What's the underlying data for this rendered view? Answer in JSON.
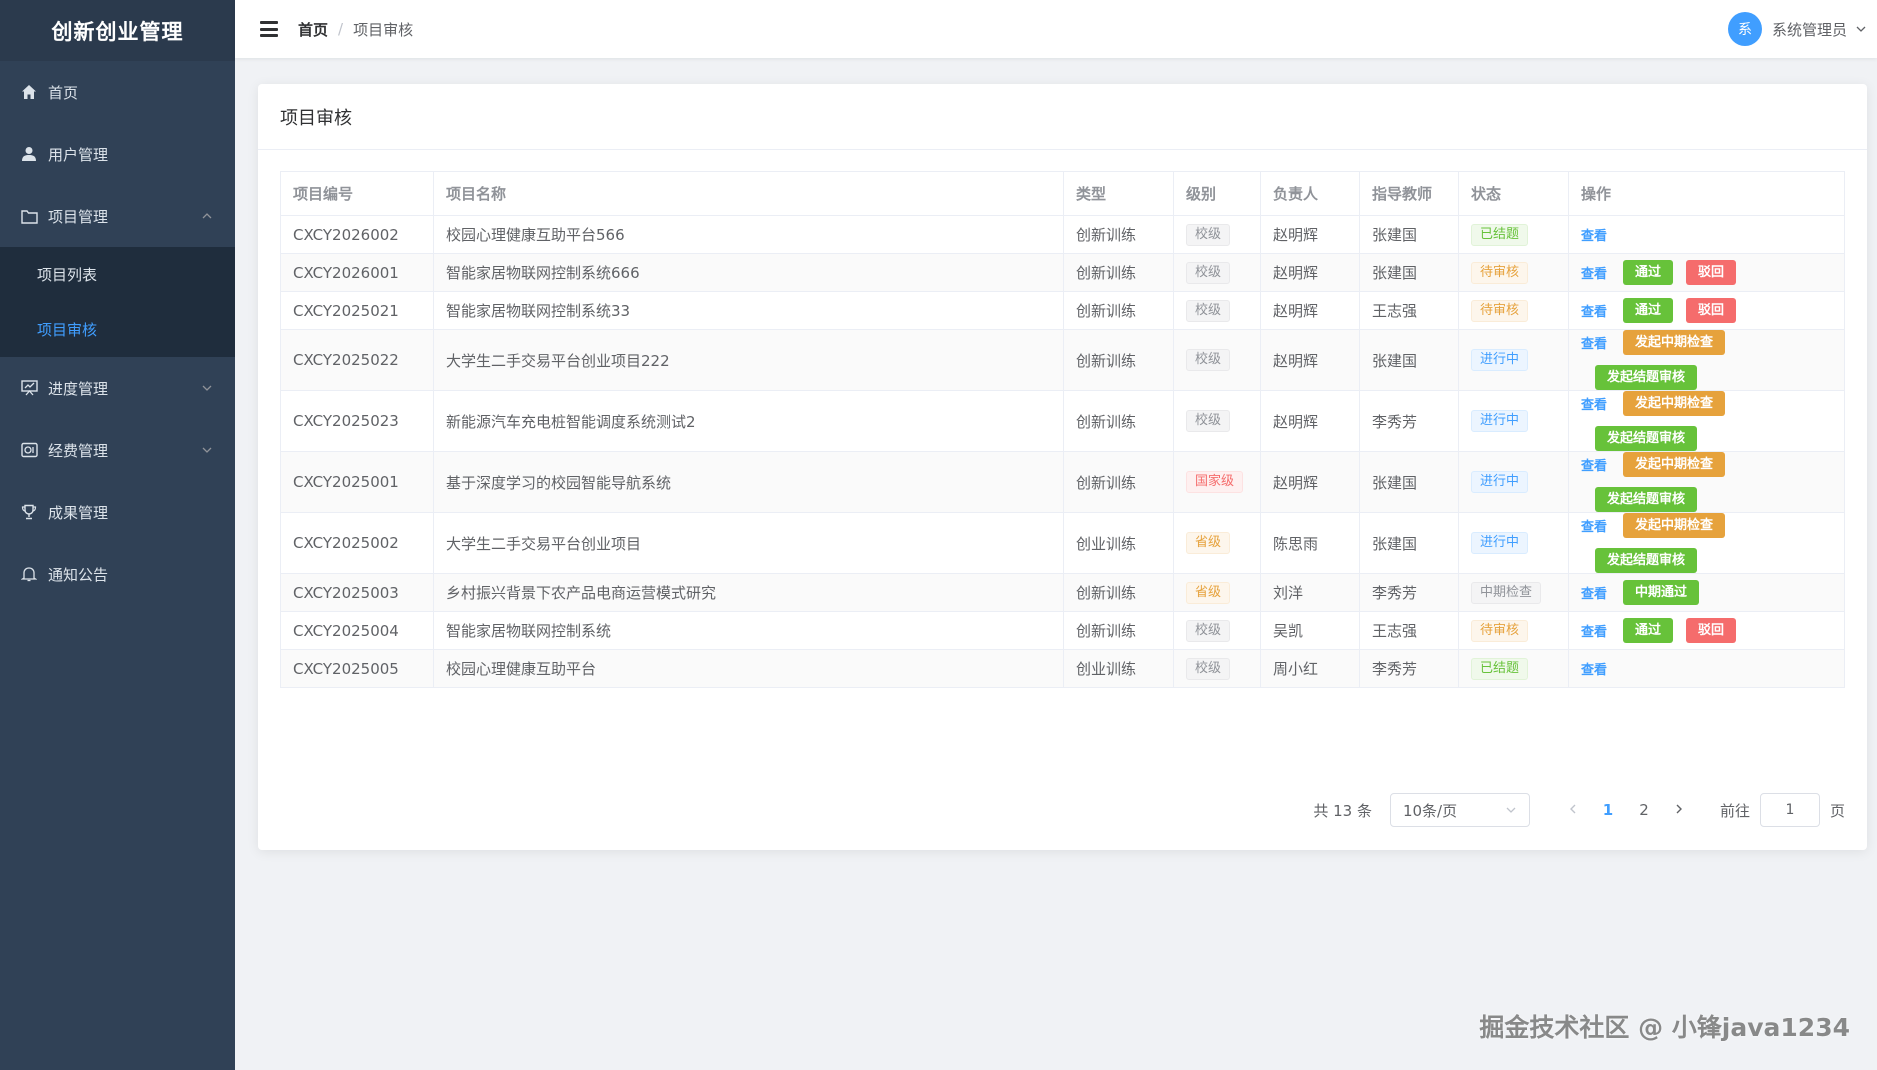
{
  "app": {
    "title": "创新创业管理"
  },
  "sidebar": {
    "items": [
      {
        "label": "首页",
        "icon": "home-icon"
      },
      {
        "label": "用户管理",
        "icon": "user-icon"
      },
      {
        "label": "项目管理",
        "icon": "folder-icon"
      },
      {
        "label": "进度管理",
        "icon": "progress-icon"
      },
      {
        "label": "经费管理",
        "icon": "funds-icon"
      },
      {
        "label": "成果管理",
        "icon": "trophy-icon"
      },
      {
        "label": "通知公告",
        "icon": "bell-icon"
      }
    ],
    "sub_items": [
      {
        "label": "项目列表"
      },
      {
        "label": "项目审核",
        "active": true
      }
    ]
  },
  "header": {
    "breadcrumb": {
      "home": "首页",
      "separator": "/",
      "current": "项目审核"
    },
    "user": {
      "avatar_text": "系",
      "name": "系统管理员"
    }
  },
  "card": {
    "title": "项目审核"
  },
  "table": {
    "columns": [
      "项目编号",
      "项目名称",
      "类型",
      "级别",
      "负责人",
      "指导教师",
      "状态",
      "操作"
    ],
    "rows": [
      {
        "code": "CXCY2026002",
        "name": "校园心理健康互助平台566",
        "type": "创新训练",
        "level": "校级",
        "leader": "赵明辉",
        "teacher": "张建国",
        "status": "已结题",
        "ops": [
          "查看"
        ]
      },
      {
        "code": "CXCY2026001",
        "name": "智能家居物联网控制系统666",
        "type": "创新训练",
        "level": "校级",
        "leader": "赵明辉",
        "teacher": "张建国",
        "status": "待审核",
        "ops": [
          "查看",
          "通过",
          "驳回"
        ]
      },
      {
        "code": "CXCY2025021",
        "name": "智能家居物联网控制系统33",
        "type": "创新训练",
        "level": "校级",
        "leader": "赵明辉",
        "teacher": "王志强",
        "status": "待审核",
        "ops": [
          "查看",
          "通过",
          "驳回"
        ]
      },
      {
        "code": "CXCY2025022",
        "name": "大学生二手交易平台创业项目222",
        "type": "创新训练",
        "level": "校级",
        "leader": "赵明辉",
        "teacher": "张建国",
        "status": "进行中",
        "ops": [
          "查看",
          "发起中期检查",
          "发起结题审核"
        ]
      },
      {
        "code": "CXCY2025023",
        "name": "新能源汽车充电桩智能调度系统测试2",
        "type": "创新训练",
        "level": "校级",
        "leader": "赵明辉",
        "teacher": "李秀芳",
        "status": "进行中",
        "ops": [
          "查看",
          "发起中期检查",
          "发起结题审核"
        ]
      },
      {
        "code": "CXCY2025001",
        "name": "基于深度学习的校园智能导航系统",
        "type": "创新训练",
        "level": "国家级",
        "leader": "赵明辉",
        "teacher": "张建国",
        "status": "进行中",
        "ops": [
          "查看",
          "发起中期检查",
          "发起结题审核"
        ]
      },
      {
        "code": "CXCY2025002",
        "name": "大学生二手交易平台创业项目",
        "type": "创业训练",
        "level": "省级",
        "leader": "陈思雨",
        "teacher": "张建国",
        "status": "进行中",
        "ops": [
          "查看",
          "发起中期检查",
          "发起结题审核"
        ]
      },
      {
        "code": "CXCY2025003",
        "name": "乡村振兴背景下农产品电商运营模式研究",
        "type": "创新训练",
        "level": "省级",
        "leader": "刘洋",
        "teacher": "李秀芳",
        "status": "中期检查",
        "ops": [
          "查看",
          "中期通过"
        ]
      },
      {
        "code": "CXCY2025004",
        "name": "智能家居物联网控制系统",
        "type": "创新训练",
        "level": "校级",
        "leader": "吴凯",
        "teacher": "王志强",
        "status": "待审核",
        "ops": [
          "查看",
          "通过",
          "驳回"
        ]
      },
      {
        "code": "CXCY2025005",
        "name": "校园心理健康互助平台",
        "type": "创业训练",
        "level": "校级",
        "leader": "周小红",
        "teacher": "李秀芳",
        "status": "已结题",
        "ops": [
          "查看"
        ]
      }
    ]
  },
  "pagination": {
    "total_text": "共 13 条",
    "page_size": "10条/页",
    "pages": [
      "1",
      "2"
    ],
    "current_page": "1",
    "goto_label": "前往",
    "goto_value": "1",
    "goto_suffix": "页"
  },
  "watermark": "掘金技术社区 @ 小锋java1234",
  "colors": {
    "sidebar_bg": "#304156",
    "submenu_bg": "#1f2d3d",
    "accent": "#409eff",
    "success": "#67c23a",
    "danger": "#f56c6c",
    "warning": "#e6a23c"
  }
}
